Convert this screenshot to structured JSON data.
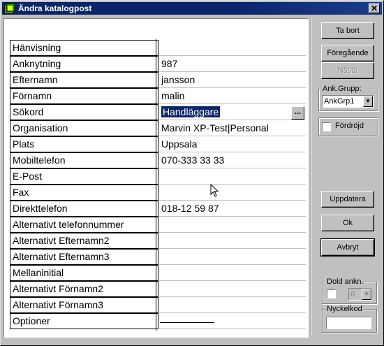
{
  "window": {
    "title": "Ändra katalogpost",
    "close_glyph": "✕"
  },
  "fields": [
    {
      "label": "Hänvisning",
      "value": ""
    },
    {
      "label": "Anknytning",
      "value": "987"
    },
    {
      "label": "Efternamn",
      "value": "jansson"
    },
    {
      "label": "Förnamn",
      "value": "malin"
    },
    {
      "label": "Sökord",
      "value": "Handläggare"
    },
    {
      "label": "Organisation",
      "value": "Marvin XP-Test|Personal"
    },
    {
      "label": "Plats",
      "value": "Uppsala"
    },
    {
      "label": "Mobiltelefon",
      "value": "070-333 33 33"
    },
    {
      "label": "E-Post",
      "value": ""
    },
    {
      "label": "Fax",
      "value": ""
    },
    {
      "label": "Direkttelefon",
      "value": "018-12 59 87"
    },
    {
      "label": "Alternativt telefonnummer",
      "value": ""
    },
    {
      "label": "Alternativt Efternamn2",
      "value": ""
    },
    {
      "label": "Alternativt Efternamn3",
      "value": ""
    },
    {
      "label": "Mellaninitial",
      "value": ""
    },
    {
      "label": "Alternativt Förnamn2",
      "value": ""
    },
    {
      "label": "Alternativt Förnamn3",
      "value": ""
    },
    {
      "label": "Optioner",
      "value": ""
    }
  ],
  "buttons": {
    "ta_bort": "Ta bort",
    "foregaende": "Föregående",
    "nasta": "Nästa",
    "uppdatera": "Uppdatera",
    "ok": "Ok",
    "avbryt": "Avbryt",
    "ellipsis": "..."
  },
  "ank_grupp": {
    "label": "Ank.Grupp:",
    "selected": "AnkGrp1"
  },
  "fordrojd": {
    "label": "Fördröjd",
    "checked": false
  },
  "dold_ankn": {
    "label": "Dold ankn.",
    "checked": false,
    "selected": "0"
  },
  "nyckelkod": {
    "label": "Nyckelkod",
    "value": ""
  },
  "colors": {
    "titlebar": "#0a246a",
    "face": "#c0c0c0",
    "selection": "#0a246a"
  }
}
